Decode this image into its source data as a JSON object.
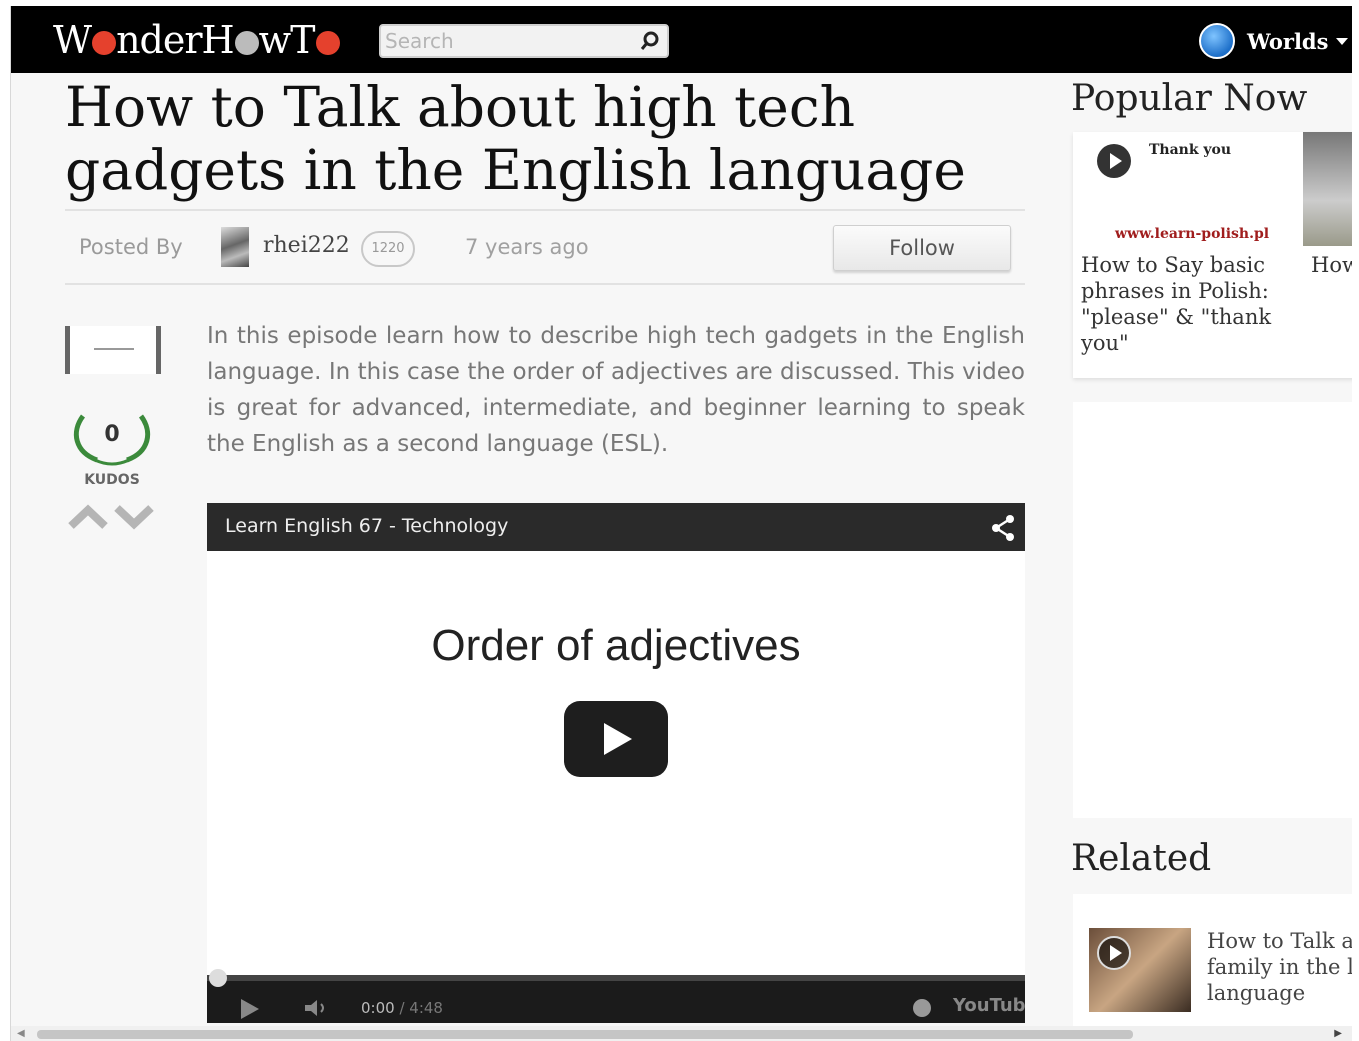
{
  "header": {
    "logo": "WonderHowTo",
    "search_placeholder": "Search",
    "worlds_label": "Worlds"
  },
  "article": {
    "title": "How to Talk about high tech gadgets in the English language",
    "posted_by_label": "Posted By",
    "author": "rhei222",
    "author_points": "1220",
    "time_ago": "7 years ago",
    "follow_label": "Follow",
    "kudos_count": "0",
    "kudos_label": "KUDOS",
    "description": "In this episode learn how to describe high tech gadgets in the English language. In this case the order of adjectives are discussed. This video is great for advanced, intermediate, and beginner learning to speak the English as a second language (ESL)."
  },
  "video": {
    "title": "Learn English 67 - Technology",
    "heading": "Order of adjectives",
    "current_time": "0:00",
    "duration": "4:48",
    "brand": "YouTube"
  },
  "sidebar": {
    "popular_heading": "Popular Now",
    "popular_items": [
      {
        "thumb_text": "Thank you",
        "thumb_url": "www.learn-polish.pl",
        "title": "How to Say basic phrases in Polish: \"please\" & \"thank you\""
      },
      {
        "title": "How a Sc"
      }
    ],
    "related_heading": "Related",
    "related_items": [
      {
        "title": "How to Talk a family in the l language"
      }
    ]
  },
  "colors": {
    "topbar": "#000000",
    "logo_dot": "#e5412d",
    "url_red": "#a01d1d",
    "kudos_green": "#3b8a3b"
  }
}
